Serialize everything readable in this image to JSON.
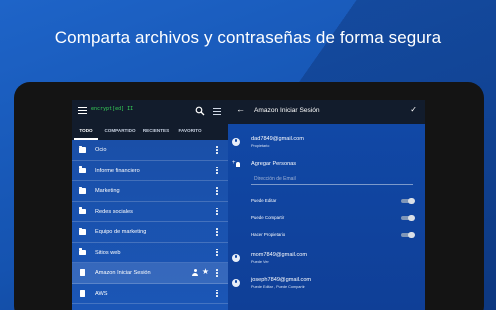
{
  "headline": "Comparta archivos y contraseñas de forma segura",
  "app": {
    "title": "encrypt[ed] II",
    "tabs": [
      "TODO",
      "COMPARTIDO",
      "RECIENTES",
      "FAVORITO"
    ]
  },
  "files": [
    {
      "label": "Ocio",
      "type": "folder"
    },
    {
      "label": "Informe financiero",
      "type": "folder"
    },
    {
      "label": "Marketing",
      "type": "folder"
    },
    {
      "label": "Redes sociales",
      "type": "folder"
    },
    {
      "label": "Equipo de marketing",
      "type": "folder"
    },
    {
      "label": "Sitios web",
      "type": "folder"
    },
    {
      "label": "Amazon Iniciar Sesión",
      "type": "document",
      "highlighted": true
    },
    {
      "label": "AWS",
      "type": "document"
    }
  ],
  "detail": {
    "title": "Amazon Iniciar Sesión",
    "owner_email": "dad7849@gmail.com",
    "owner_role": "Propietario",
    "add_people": "Agregar Personas",
    "email_placeholder": "Dirección de Email",
    "permissions": [
      "Puede Editar",
      "Puede Compartir",
      "Hacer Propietario"
    ],
    "members": [
      {
        "email": "mom7849@gmail.com",
        "role": "Puede Ver"
      },
      {
        "email": "joseph7849@gmail.com",
        "role": "Puede Editar , Puede Compartir"
      }
    ]
  },
  "colors": {
    "accent": "#1e64c8",
    "appbar": "#121c2c",
    "title_green": "#37d158"
  },
  "icons": [
    "menu-icon",
    "search-icon",
    "list-view-icon",
    "folder-icon",
    "document-icon",
    "more-vert-icon",
    "person-icon",
    "star-icon",
    "back-arrow-icon",
    "check-icon",
    "account-icon",
    "person-add-icon"
  ]
}
